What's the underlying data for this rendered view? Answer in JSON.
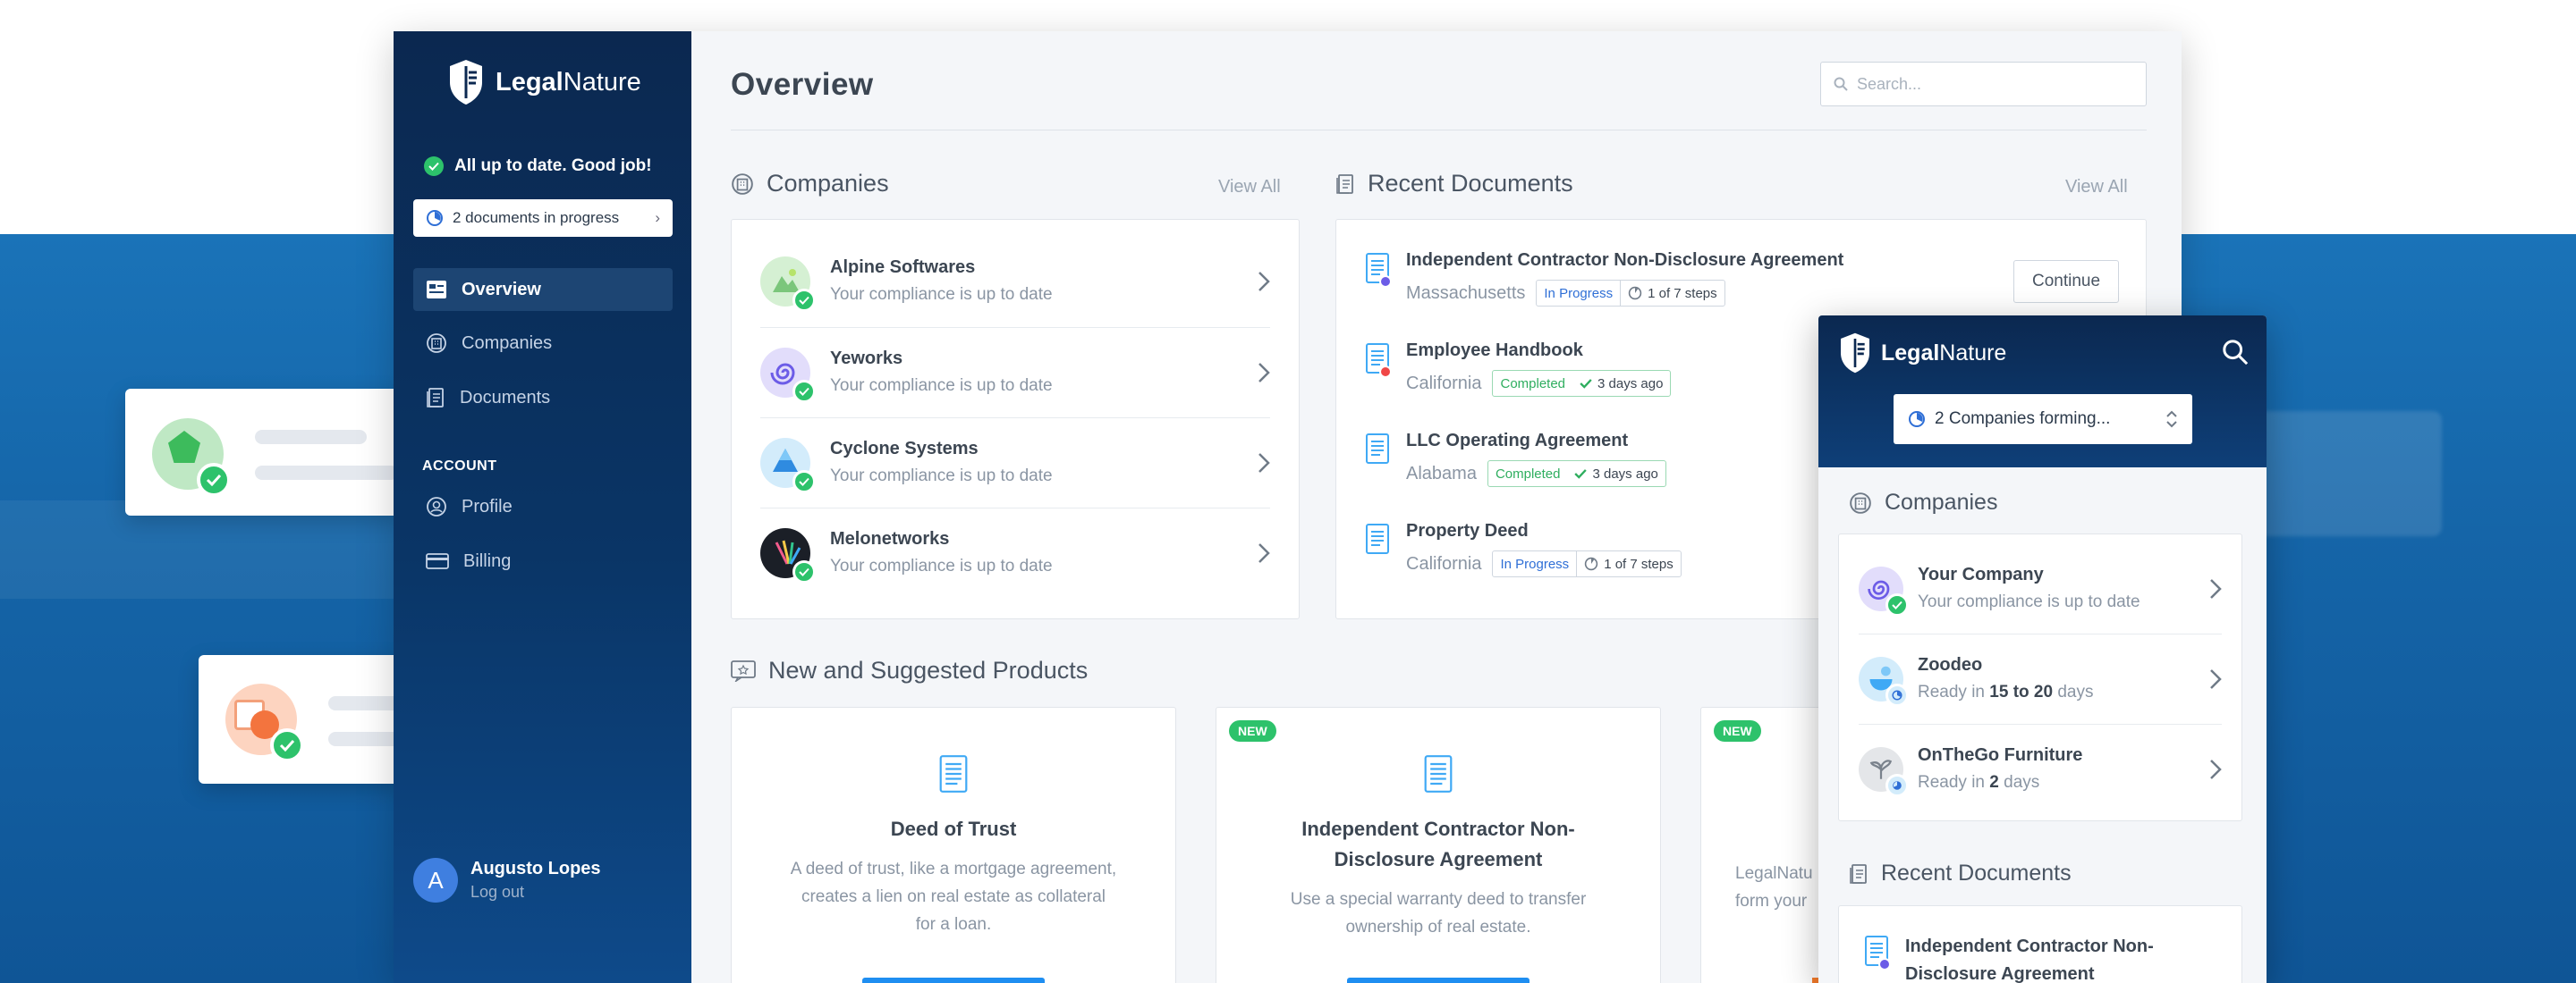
{
  "brand": {
    "name_bold": "Legal",
    "name_light": "Nature"
  },
  "sidebar": {
    "status_text": "All up to date. Good job!",
    "progress_pill": "2 documents in progress",
    "nav": [
      {
        "label": "Overview",
        "icon": "overview-icon",
        "active": true
      },
      {
        "label": "Companies",
        "icon": "companies-icon"
      },
      {
        "label": "Documents",
        "icon": "documents-icon"
      }
    ],
    "account_heading": "ACCOUNT",
    "account_nav": [
      {
        "label": "Profile",
        "icon": "profile-icon"
      },
      {
        "label": "Billing",
        "icon": "billing-icon"
      }
    ],
    "user": {
      "initial": "A",
      "name": "Augusto Lopes",
      "logout": "Log out"
    }
  },
  "main": {
    "title": "Overview",
    "search_placeholder": "Search...",
    "companies": {
      "title": "Companies",
      "view_all": "View All",
      "items": [
        {
          "name": "Alpine Softwares",
          "status": "Your compliance is up to date",
          "color": "#7bc67b"
        },
        {
          "name": "Yeworks",
          "status": "Your compliance is up to date",
          "color": "#6c5ce7"
        },
        {
          "name": "Cyclone Systems",
          "status": "Your compliance is up to date",
          "color": "#3fa9f5"
        },
        {
          "name": "Melonetworks",
          "status": "Your compliance is up to date",
          "color": "#1b1f27"
        }
      ]
    },
    "documents": {
      "title": "Recent Documents",
      "view_all": "View All",
      "continue_label": "Continue",
      "items": [
        {
          "title": "Independent Contractor Non-Disclosure Agreement",
          "state": "Massachusetts",
          "tag": "In Progress",
          "detail": "1 of 7 steps"
        },
        {
          "title": "Employee Handbook",
          "state": "California",
          "tag": "Completed",
          "detail": "3 days ago"
        },
        {
          "title": "LLC Operating Agreement",
          "state": "Alabama",
          "tag": "Completed",
          "detail": "3 days ago"
        },
        {
          "title": "Property Deed",
          "state": "California",
          "tag": "In Progress",
          "detail": "1 of 7 steps"
        }
      ]
    },
    "products": {
      "title": "New and Suggested Products",
      "new_badge": "NEW",
      "items": [
        {
          "title": "Deed of Trust",
          "desc_lines": [
            "A deed of trust, like a mortgage agreement,",
            "creates a lien on real estate as collateral",
            "for a loan."
          ]
        },
        {
          "title_lines": [
            "Independent Contractor Non-",
            "Disclosure Agreement"
          ],
          "desc_lines": [
            "Use a special warranty deed to transfer",
            "ownership of real estate."
          ]
        },
        {
          "desc_lines": [
            "LegalNatu",
            "form your"
          ]
        }
      ]
    }
  },
  "mobile": {
    "selector": "2 Companies forming...",
    "companies_title": "Companies",
    "companies": [
      {
        "name": "Your Company",
        "status": "Your compliance is up to date"
      },
      {
        "name": "Zoodeo",
        "status_pre": "Ready in ",
        "status_bold": "15 to 20",
        "status_post": " days"
      },
      {
        "name": "OnTheGo Furniture",
        "status_pre": "Ready in ",
        "status_bold": "2",
        "status_post": " days"
      }
    ],
    "documents_title": "Recent Documents",
    "doc_lines": [
      "Independent Contractor Non-",
      "Disclosure Agreement"
    ]
  },
  "colors": {
    "accent": "#1f8ef1",
    "success": "#2dc26b",
    "sidebar": "#0b2850",
    "progress": "#2f6fd6"
  }
}
